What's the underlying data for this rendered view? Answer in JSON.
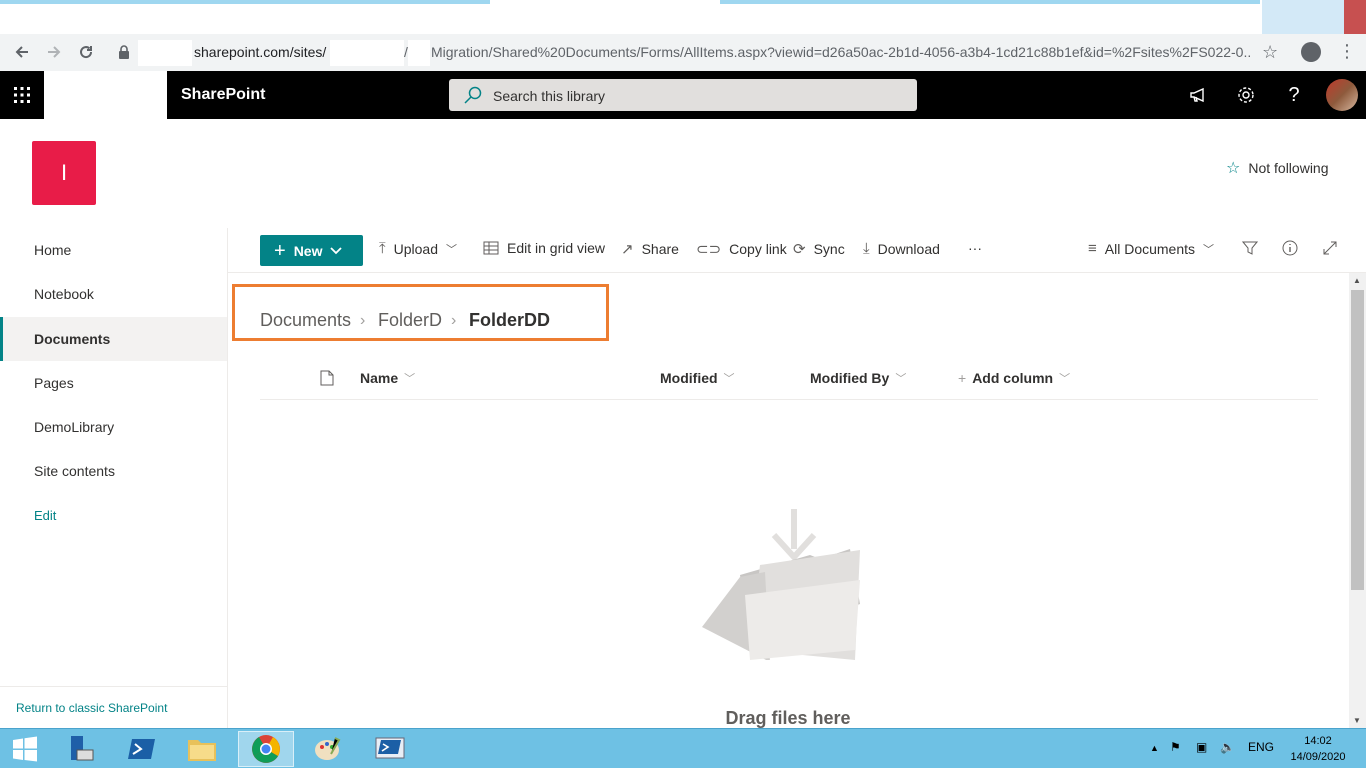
{
  "browser": {
    "url_host": "sharepoint.com/sites/",
    "url_sep": "/",
    "url_path": "Migration/Shared%20Documents/Forms/AllItems.aspx?viewid=d26a50ac-2b1d-4056-a3b4-1cd21c88b1ef&id=%2Fsites%2FS022-0..."
  },
  "suitebar": {
    "brand": "SharePoint",
    "search_placeholder": "Search this library"
  },
  "site": {
    "logo_letter": "I",
    "follow_label": "Not following"
  },
  "nav": {
    "items": [
      {
        "label": "Home"
      },
      {
        "label": "Notebook"
      },
      {
        "label": "Documents"
      },
      {
        "label": "Pages"
      },
      {
        "label": "DemoLibrary"
      },
      {
        "label": "Site contents"
      }
    ],
    "edit_label": "Edit",
    "classic_label": "Return to classic SharePoint"
  },
  "commandbar": {
    "new_label": "New",
    "upload_label": "Upload",
    "grid_label": "Edit in grid view",
    "share_label": "Share",
    "copylink_label": "Copy link",
    "sync_label": "Sync",
    "download_label": "Download",
    "more_label": "···",
    "view_label": "All Documents"
  },
  "breadcrumb": {
    "items": [
      "Documents",
      "FolderD",
      "FolderDD"
    ]
  },
  "columns": {
    "name": "Name",
    "modified": "Modified",
    "modified_by": "Modified By",
    "add_column": "Add column"
  },
  "empty_state": {
    "text": "Drag files here"
  },
  "taskbar": {
    "lang": "ENG",
    "time": "14:02",
    "date": "14/09/2020"
  },
  "colors": {
    "accent": "#038387",
    "site_logo": "#e81c48",
    "highlight_box": "#ed7d31"
  }
}
